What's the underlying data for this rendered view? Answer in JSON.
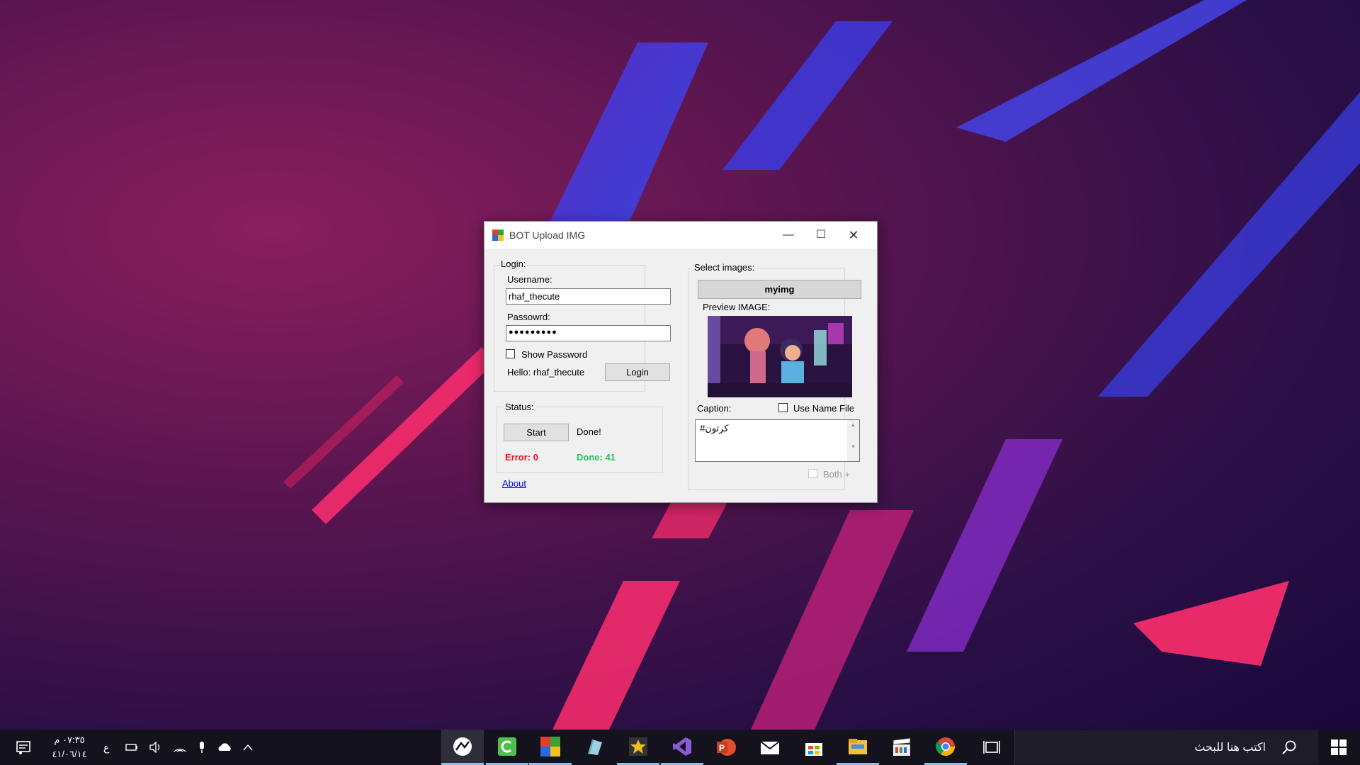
{
  "window": {
    "title": "BOT Upload IMG",
    "controls": {
      "minimize": "—",
      "maximize": "☐",
      "close": "✕"
    }
  },
  "login": {
    "group_title": "Login:",
    "username_label": "Username:",
    "username_value": "rhaf_thecute",
    "password_label": "Passowrd:",
    "password_value": "●●●●●●●●●",
    "show_password_label": "Show Password",
    "show_password_checked": false,
    "hello_text": "Hello: rhaf_thecute",
    "login_button": "Login"
  },
  "status": {
    "group_title": "Status:",
    "start_button": "Start",
    "done_text": "Done!",
    "error_text": "Error: 0",
    "done_count_text": "Done: 41",
    "error_color": "#e81123",
    "done_color": "#22c55e"
  },
  "about_link": "About",
  "images": {
    "group_title": "Select images:",
    "folder_button": "myimg",
    "preview_label": "Preview IMAGE:",
    "caption_label": "Caption:",
    "use_name_file_label": "Use Name File",
    "use_name_file_checked": false,
    "caption_text": "#كرتون",
    "both_label": "Both +",
    "both_enabled": false
  },
  "taskbar": {
    "time": "٠٧:٣٥ م",
    "date": "٤١/٠٦/١٤",
    "language": "ع",
    "search_placeholder": "اكتب هنا للبحث",
    "apps": [
      "remote-desktop-icon",
      "camtasia-icon",
      "app-icon",
      "cube-icon",
      "star-app-icon",
      "visual-studio-icon",
      "powerpoint-icon",
      "mail-icon",
      "store-icon",
      "file-explorer-icon",
      "movie-maker-icon",
      "chrome-icon"
    ]
  }
}
